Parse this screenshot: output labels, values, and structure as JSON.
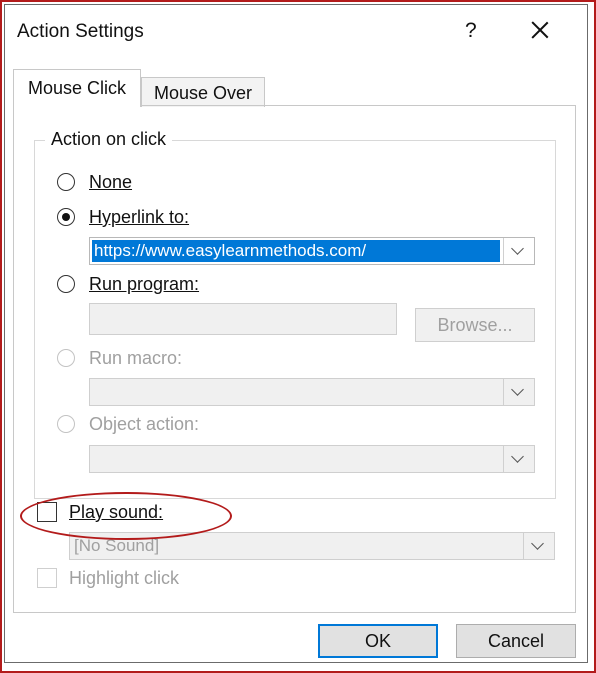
{
  "window": {
    "title": "Action Settings",
    "help_label": "?",
    "close_icon": "close-icon"
  },
  "tabs": [
    {
      "label": "Mouse Click",
      "active": true
    },
    {
      "label": "Mouse Over",
      "active": false
    }
  ],
  "action_group": {
    "legend": "Action on click",
    "options": [
      {
        "label": "None",
        "checked": false,
        "enabled": true
      },
      {
        "label": "Hyperlink to:",
        "checked": true,
        "enabled": true
      },
      {
        "label": "Run program:",
        "checked": false,
        "enabled": true
      },
      {
        "label": "Run macro:",
        "checked": false,
        "enabled": false
      },
      {
        "label": "Object action:",
        "checked": false,
        "enabled": false
      }
    ],
    "hyperlink_value": "https://www.easylearnmethods.com/",
    "program_value": "",
    "browse_label": "Browse...",
    "macro_value": "",
    "object_action_value": ""
  },
  "play_sound": {
    "label": "Play sound:",
    "checked": false,
    "value": "[No Sound]"
  },
  "highlight_click": {
    "label": "Highlight click",
    "checked": false,
    "enabled": false
  },
  "footer": {
    "ok_label": "OK",
    "cancel_label": "Cancel"
  },
  "colors": {
    "annotation": "#b31b1b",
    "selection": "#0078d7"
  }
}
